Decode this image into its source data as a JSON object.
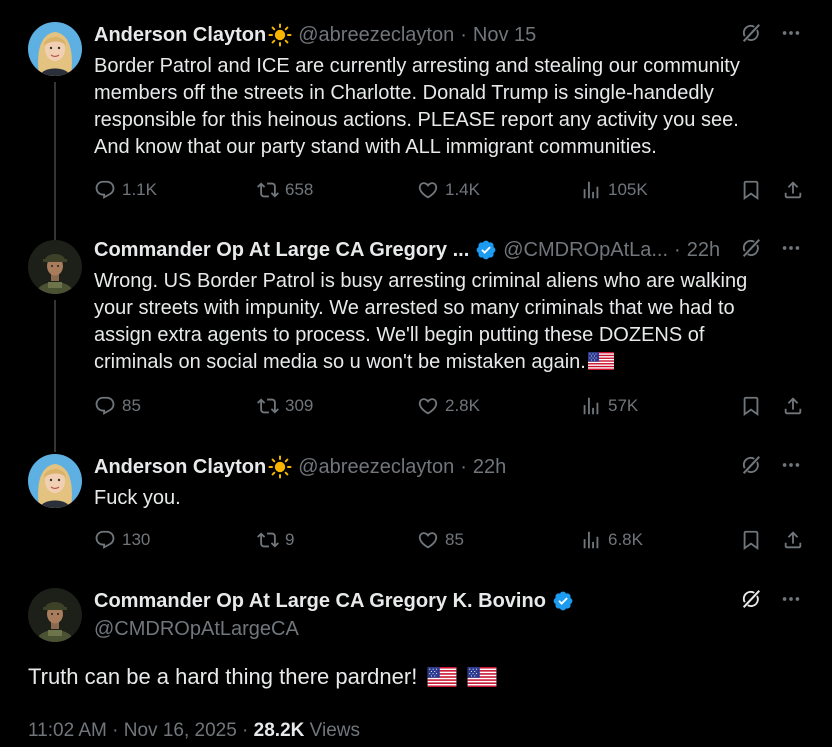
{
  "tweets": [
    {
      "name": "Anderson Clayton",
      "handle": "@abreezeclayton",
      "separator": "·",
      "time": "Nov 15",
      "lines": [
        "Border Patrol and ICE are currently arresting and stealing our community",
        "members off the streets in Charlotte. Donald Trump is single-handedly",
        "responsible for this heinous actions. PLEASE report any activity you see.",
        "And know that our party stand with ALL immigrant communities."
      ],
      "replies": "1.1K",
      "reposts": "658",
      "likes": "1.4K",
      "views": "105K"
    },
    {
      "name": "Commander Op At Large CA Gregory ...",
      "handle": "@CMDROpAtLa...",
      "separator": "·",
      "time": "22h",
      "lines": [
        "Wrong.  US Border Patrol is busy arresting criminal aliens who are walking",
        "your streets with impunity.  We arrested so many criminals that we had to",
        "assign extra agents to process.  We'll begin putting these DOZENS of",
        "criminals on social media so u won't be mistaken again."
      ],
      "replies": "85",
      "reposts": "309",
      "likes": "2.8K",
      "views": "57K"
    },
    {
      "name": "Anderson Clayton",
      "handle": "@abreezeclayton",
      "separator": "·",
      "time": "22h",
      "lines": [
        "Fuck you."
      ],
      "replies": "130",
      "reposts": "9",
      "likes": "85",
      "views": "6.8K"
    }
  ],
  "main": {
    "name": "Commander Op At Large CA Gregory K. Bovino",
    "handle": "@CMDROpAtLargeCA",
    "text": "Truth can be a hard thing there pardner!",
    "timestamp": "11:02 AM · Nov 16, 2025 · ",
    "views_count": "28.2K",
    "views_label": "Views"
  },
  "icons": {
    "reply": "reply-icon",
    "repost": "repost-icon",
    "like": "heart-icon",
    "views": "views-icon",
    "bookmark": "bookmark-icon",
    "share": "share-icon",
    "grok": "grok-icon",
    "more": "more-icon",
    "sun": "sun-emoji-icon",
    "verified": "verified-badge-icon",
    "flag": "us-flag-emoji-icon"
  },
  "colors": {
    "background": "#000000",
    "text": "#e7e9ea",
    "muted": "#71767b",
    "verified": "#1d9bf0",
    "sun": "#f7b500"
  }
}
